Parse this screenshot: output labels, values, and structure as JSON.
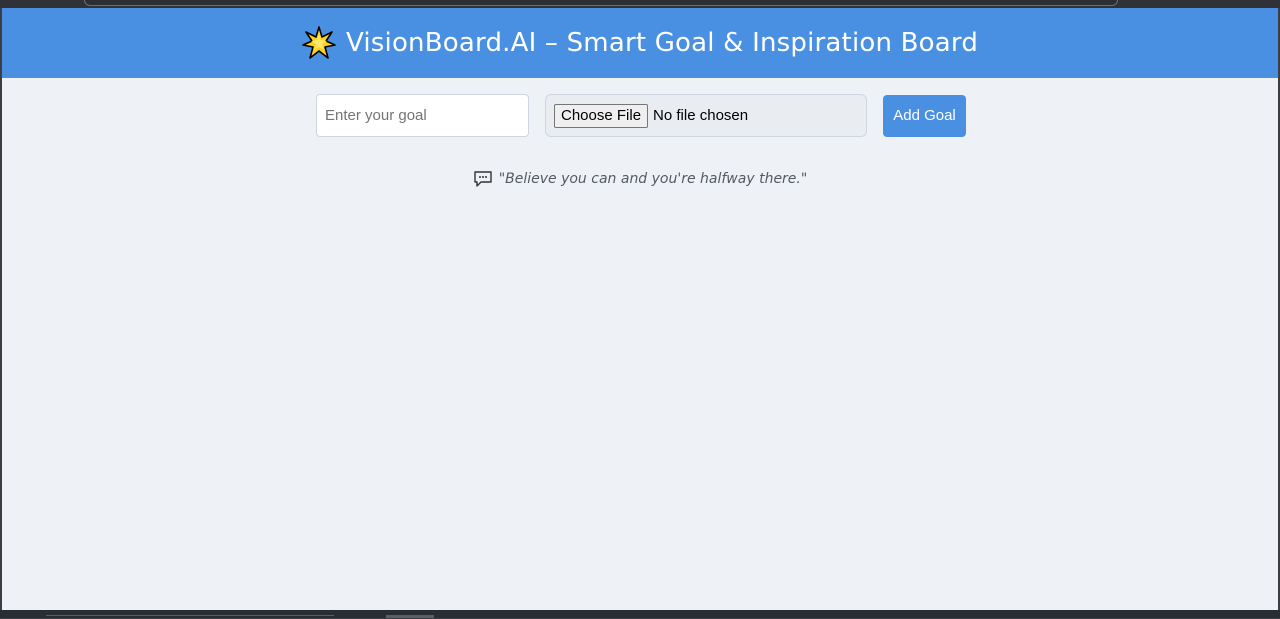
{
  "header": {
    "icon": "star-icon",
    "title": "VisionBoard.AI – Smart Goal & Inspiration Board"
  },
  "form": {
    "goal_placeholder": "Enter your goal",
    "goal_value": "",
    "file_button_label": "Choose File",
    "file_status": "No file chosen",
    "add_button_label": "Add Goal"
  },
  "quote": {
    "icon": "speech-bubble-icon",
    "text": "\"Believe you can and you're halfway there.\""
  },
  "colors": {
    "accent": "#4a90e2",
    "background": "#eef2f7",
    "star": "#ffd21a"
  }
}
